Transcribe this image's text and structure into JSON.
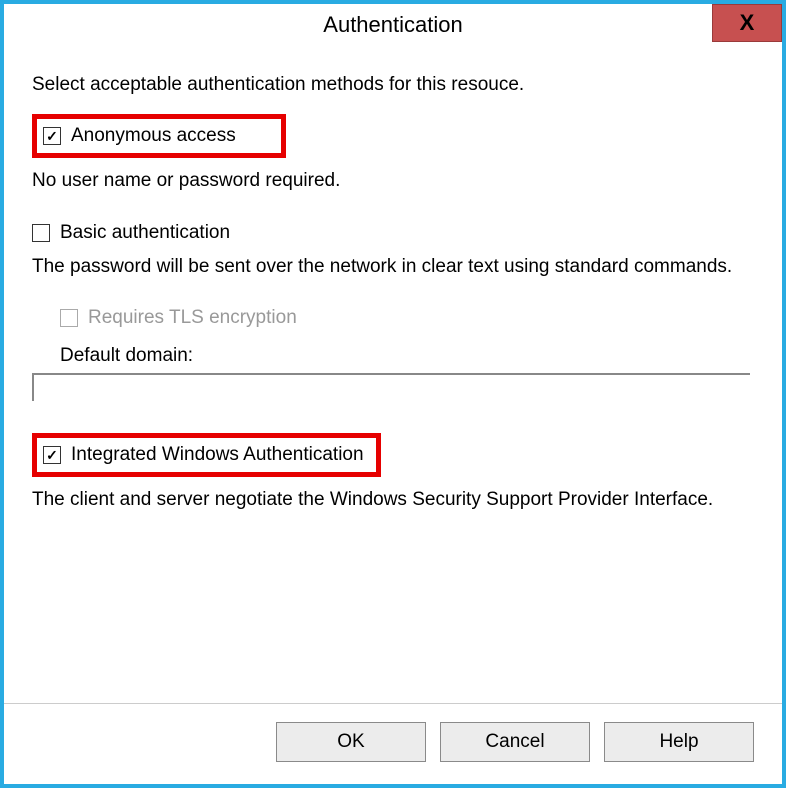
{
  "window": {
    "title": "Authentication",
    "close_glyph": "X"
  },
  "instruction": "Select acceptable authentication methods for this resouce.",
  "anonymous": {
    "label": "Anonymous access",
    "checked": true,
    "desc": "No user name or password required."
  },
  "basic": {
    "label": "Basic authentication",
    "checked": false,
    "desc": "The password will be sent over the network in clear text using standard commands.",
    "tls": {
      "label": "Requires TLS encryption",
      "checked": false,
      "enabled": false
    },
    "domain_label": "Default domain:",
    "domain_value": ""
  },
  "integrated": {
    "label": "Integrated Windows Authentication",
    "checked": true,
    "desc": "The client and server negotiate the Windows Security Support Provider Interface."
  },
  "buttons": {
    "ok": "OK",
    "cancel": "Cancel",
    "help": "Help"
  },
  "checkmark_glyph": "✓"
}
